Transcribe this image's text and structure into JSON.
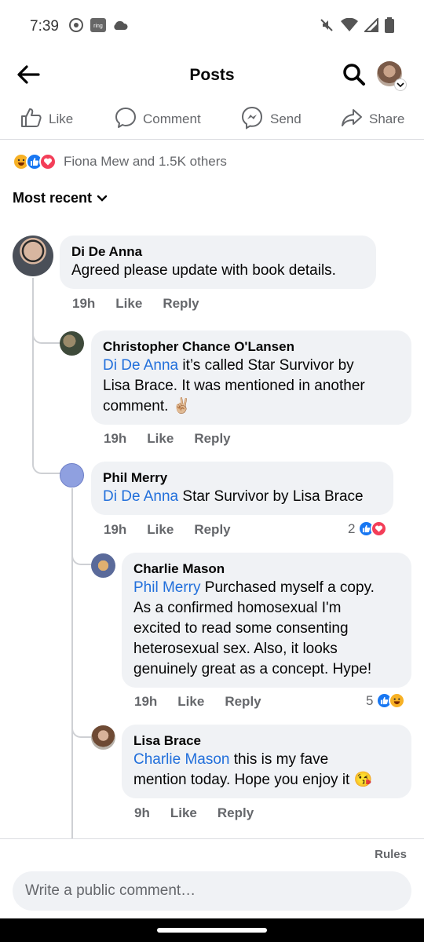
{
  "status": {
    "time": "7:39"
  },
  "header": {
    "title": "Posts"
  },
  "actions": {
    "like": "Like",
    "comment": "Comment",
    "send": "Send",
    "share": "Share"
  },
  "reactions": {
    "summary": "Fiona Mew and 1.5K others"
  },
  "sort": {
    "label": "Most recent"
  },
  "comments": [
    {
      "author": "Di De Anna",
      "text": "Agreed please update with book details.",
      "time": "19h",
      "like": "Like",
      "reply": "Reply"
    },
    {
      "author": "Christopher Chance O'Lansen",
      "mention": "Di De Anna",
      "text_line1": "it’s called Star Survivor by",
      "text_line2": "Lisa Brace. It was mentioned in another",
      "text_line3": "comment. ✌🏼",
      "time": "19h",
      "like": "Like",
      "reply": "Reply"
    },
    {
      "author": "Phil Merry",
      "mention": "Di De Anna",
      "text": "Star Survivor by Lisa Brace",
      "time": "19h",
      "like": "Like",
      "reply": "Reply",
      "reaction_count": "2"
    },
    {
      "author": "Charlie Mason",
      "mention": "Phil Merry",
      "text_line1": "Purchased myself a copy.",
      "text_line2": "As a confirmed homosexual I'm",
      "text_line3": "excited to read some consenting",
      "text_line4": "heterosexual sex. Also, it looks",
      "text_line5": "genuinely great as a concept. Hype!",
      "time": "19h",
      "like": "Like",
      "reply": "Reply",
      "reaction_count": "5"
    },
    {
      "author": "Lisa Brace",
      "mention": "Charlie Mason",
      "text_line1": "this is my fave",
      "text_line2": "mention today. Hope you enjoy it 😘",
      "time": "9h",
      "like": "Like",
      "reply": "Reply"
    }
  ],
  "footer": {
    "rules": "Rules",
    "composer_placeholder": "Write a public comment…"
  },
  "colors": {
    "link": "#216fdb",
    "like_blue": "#1877f2",
    "love_red": "#f33e58",
    "bubble_bg": "#f0f2f5",
    "meta_gray": "#65676b"
  }
}
